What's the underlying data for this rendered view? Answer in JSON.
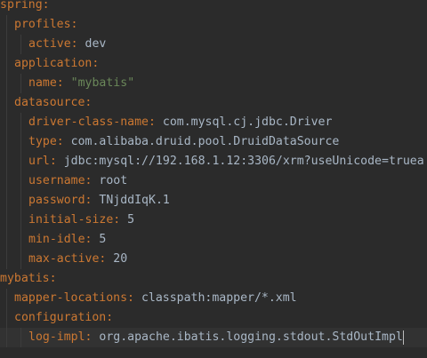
{
  "lines": [
    {
      "indent": 0,
      "key": "spring",
      "sep": ":",
      "value": ""
    },
    {
      "indent": 1,
      "key": "profiles",
      "sep": ":",
      "value": ""
    },
    {
      "indent": 2,
      "key": "active",
      "sep": ":",
      "value": " dev"
    },
    {
      "indent": 1,
      "key": "application",
      "sep": ":",
      "value": ""
    },
    {
      "indent": 2,
      "key": "name",
      "sep": ":",
      "value": " ",
      "string": "\"mybatis\""
    },
    {
      "indent": 1,
      "key": "datasource",
      "sep": ":",
      "value": ""
    },
    {
      "indent": 2,
      "key": "driver-class-name",
      "sep": ":",
      "value": " com.mysql.cj.jdbc.Driver"
    },
    {
      "indent": 2,
      "key": "type",
      "sep": ":",
      "value": " com.alibaba.druid.pool.DruidDataSource"
    },
    {
      "indent": 2,
      "key": "url",
      "sep": ":",
      "value": " jdbc:mysql://192.168.1.12:3306/xrm?useUnicode=truea"
    },
    {
      "indent": 2,
      "key": "username",
      "sep": ":",
      "value": " root"
    },
    {
      "indent": 2,
      "key": "password",
      "sep": ":",
      "value": " TNjddIqK.1"
    },
    {
      "indent": 2,
      "key": "initial-size",
      "sep": ":",
      "value": " 5"
    },
    {
      "indent": 2,
      "key": "min-idle",
      "sep": ":",
      "value": " 5"
    },
    {
      "indent": 2,
      "key": "max-active",
      "sep": ":",
      "value": " 20"
    },
    {
      "indent": 0,
      "key": "mybatis",
      "sep": ":",
      "value": ""
    },
    {
      "indent": 1,
      "key": "mapper-locations",
      "sep": ":",
      "value": " classpath:mapper/*.xml"
    },
    {
      "indent": 1,
      "key": "configuration",
      "sep": ":",
      "value": ""
    },
    {
      "indent": 2,
      "key": "log-impl",
      "sep": ":",
      "value": " org.apache.ibatis.logging.stdout.StdOutImpl",
      "current": true
    }
  ],
  "colors": {
    "background": "#2b2b2b",
    "key": "#cc7832",
    "value": "#a9b7c6",
    "string": "#6a8759",
    "current_line": "#323232"
  }
}
